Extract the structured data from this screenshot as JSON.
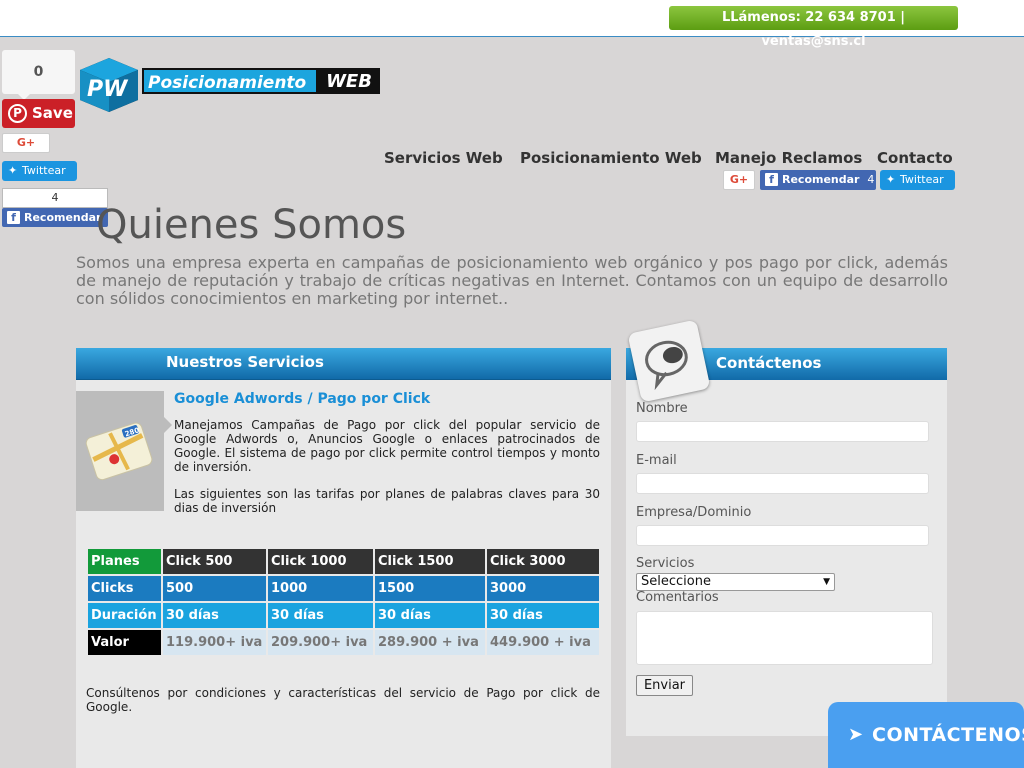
{
  "topbar": {
    "contact_line": "LLámenos: 22 634 8701 | ventas@sns.cl"
  },
  "share": {
    "pin_count": "0",
    "pin_label": "Save",
    "gplus_label": "G+",
    "tweet_label": "Twittear",
    "fb_count": "4",
    "fb_label": "Recomendar"
  },
  "logo": {
    "letters": "PW",
    "word1": "Posicionamiento",
    "word2": "WEB"
  },
  "nav": {
    "items": [
      "Servicios Web",
      "Posicionamiento Web",
      "Manejo Reclamos",
      "Contacto"
    ],
    "gplus_label": "G+",
    "fb_label": "Recomendar",
    "fb_count": "4",
    "tweet_label": "Twittear"
  },
  "page": {
    "title": "Quienes Somos",
    "intro": "Somos una empresa experta en campañas de posicionamiento web orgánico y pos pago por click, además de manejo de reputación y trabajo de críticas negativas en Internet. Contamos con un equipo de desarrollo con sólidos conocimientos en marketing por internet.."
  },
  "services": {
    "header": "Nuestros Servicios",
    "item_title": "Google Adwords / Pago por Click",
    "p1": "Manejamos Campañas de Pago por click del popular servicio de Google Adwords o, Anuncios Google o enlaces patrocinados de Google. El sistema de pago por click permite control tiempos y monto de inversión.",
    "p2": "Las siguientes son las tarifas por planes de palabras claves para 30 dias de inversión",
    "map_badge": "280",
    "table": {
      "headers": [
        "Planes",
        "Click 500",
        "Click 1000",
        "Click 1500",
        "Click 3000"
      ],
      "rows": [
        [
          "Clicks",
          "500",
          "1000",
          "1500",
          "3000"
        ],
        [
          "Duración",
          "30 días",
          "30 días",
          "30 días",
          "30 días"
        ],
        [
          "Valor",
          "119.900+ iva",
          "209.900+ iva",
          "289.900 + iva",
          "449.900 + iva"
        ]
      ]
    },
    "footer": "Consúltenos por condiciones y características del servicio de Pago por click de Google."
  },
  "contact": {
    "header": "Contáctenos",
    "label_name": "Nombre",
    "label_email": "E-mail",
    "label_company": "Empresa/Dominio",
    "label_services": "Servicios",
    "select_value": "Seleccione",
    "label_comments": "Comentarios",
    "submit": "Enviar"
  },
  "floating": {
    "label": "CONTÁCTENOS"
  },
  "colors": {
    "accent_blue": "#1ca5de",
    "green": "#129a3a",
    "header_blue": "#116aa8"
  }
}
